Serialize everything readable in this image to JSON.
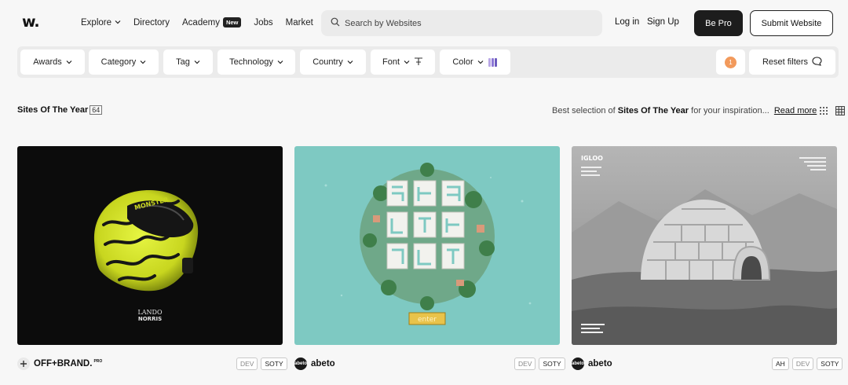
{
  "nav": {
    "logo": "w.",
    "links": [
      {
        "label": "Explore",
        "has_dropdown": true
      },
      {
        "label": "Directory",
        "has_dropdown": false
      },
      {
        "label": "Academy",
        "badge": "New"
      },
      {
        "label": "Jobs",
        "has_dropdown": false
      },
      {
        "label": "Market",
        "has_dropdown": false
      }
    ],
    "search_placeholder": "Search by Websites",
    "login": "Log in",
    "signup": "Sign Up",
    "be_pro": "Be Pro",
    "submit": "Submit Website"
  },
  "filters": {
    "items": [
      {
        "label": "Awards"
      },
      {
        "label": "Category"
      },
      {
        "label": "Tag"
      },
      {
        "label": "Technology"
      },
      {
        "label": "Country"
      },
      {
        "label": "Font"
      },
      {
        "label": "Color"
      }
    ],
    "active_count": "1",
    "reset": "Reset filters",
    "color_swatches": [
      "#b9a7e6",
      "#8c77d6",
      "#6d5bbf"
    ]
  },
  "section": {
    "title": "Sites Of The Year",
    "count": "64",
    "desc_prefix": "Best selection of",
    "desc_bold": "Sites Of The Year",
    "desc_suffix": "for your inspiration...",
    "read_more": "Read more"
  },
  "cards": [
    {
      "author": "OFF+BRAND.",
      "author_badge": "PRO",
      "author_logo_color": "#e9e9e9",
      "tags": [
        "DEV",
        "SOTY"
      ],
      "thumb_bg": "#0c0c0c",
      "thumb_text": "LANDO\nNORRIS"
    },
    {
      "author": "abeto",
      "author_badge": "",
      "author_logo_color": "#1a1a1a",
      "tags": [
        "DEV",
        "SOTY"
      ],
      "thumb_bg": "#7ec9c2",
      "thumb_text": "enter"
    },
    {
      "author": "abeto",
      "author_badge": "",
      "author_logo_color": "#1a1a1a",
      "tags": [
        "AH",
        "DEV",
        "SOTY"
      ],
      "thumb_bg": "#8e8e8e",
      "thumb_text": "IGLOO"
    }
  ],
  "colors": {
    "accent_dark": "#1d1d1d",
    "count_dot": "#f29a5c",
    "background": "#f7f7f7",
    "filterbar": "#ebebeb"
  }
}
